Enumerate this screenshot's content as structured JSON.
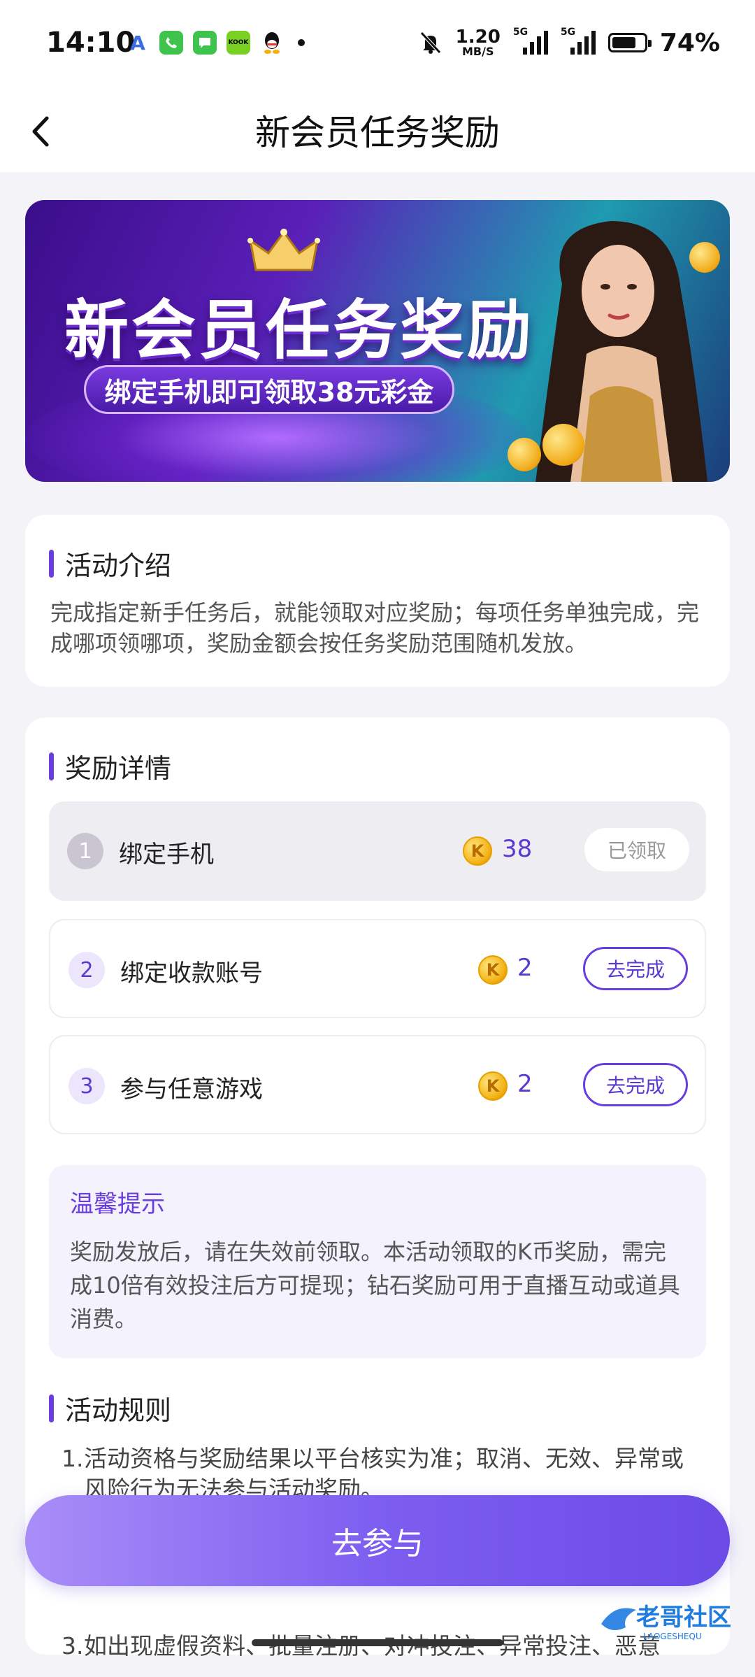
{
  "status_bar": {
    "time": "14:10",
    "net_speed_value": "1.20",
    "net_speed_unit": "MB/S",
    "signal1_label": "5G",
    "signal2_label": "5G",
    "battery": "74%",
    "battery_level": 0.74,
    "app_icons": [
      "font-app-icon",
      "phone-app-icon",
      "messages-app-icon",
      "kook-app-icon",
      "qq-app-icon"
    ],
    "kook_label": "KOOK"
  },
  "nav": {
    "title": "新会员任务奖励"
  },
  "banner": {
    "title": "新会员任务奖励",
    "subtitle": "绑定手机即可领取38元彩金"
  },
  "intro": {
    "title": "活动介绍",
    "text": "完成指定新手任务后，就能领取对应奖励；每项任务单独完成，完成哪项领哪项，奖励金额会按任务奖励范围随机发放。"
  },
  "rewards": {
    "title": "奖励详情",
    "coin_letter": "K",
    "tasks": [
      {
        "num": "1",
        "label": "绑定手机",
        "amount": "38",
        "button": "已领取",
        "status": "claimed"
      },
      {
        "num": "2",
        "label": "绑定收款账号",
        "amount": "2",
        "button": "去完成",
        "status": "todo"
      },
      {
        "num": "3",
        "label": "参与任意游戏",
        "amount": "2",
        "button": "去完成",
        "status": "todo"
      }
    ],
    "tip": {
      "title": "温馨提示",
      "text": "奖励发放后，请在失效前领取。本活动领取的K币奖励，需完成10倍有效投注后方可提现；钻石奖励可用于直播互动或道具消费。"
    },
    "rules_title": "活动规则",
    "rules": [
      {
        "num": "1.",
        "text": "活动资格与奖励结果以平台核实为准；取消、无效、异常或风险行为无法参与活动奖励。"
      },
      {
        "num": "3.",
        "text": "如出现虚假资料、批量注册、对冲投注、异常投注、恶意"
      }
    ]
  },
  "cta": {
    "label": "去参与"
  },
  "watermark": {
    "text": "老哥社区",
    "subtext": "LAOGESHEQU"
  },
  "colors": {
    "accent": "#6a3de0",
    "coin": "#f3b315"
  }
}
